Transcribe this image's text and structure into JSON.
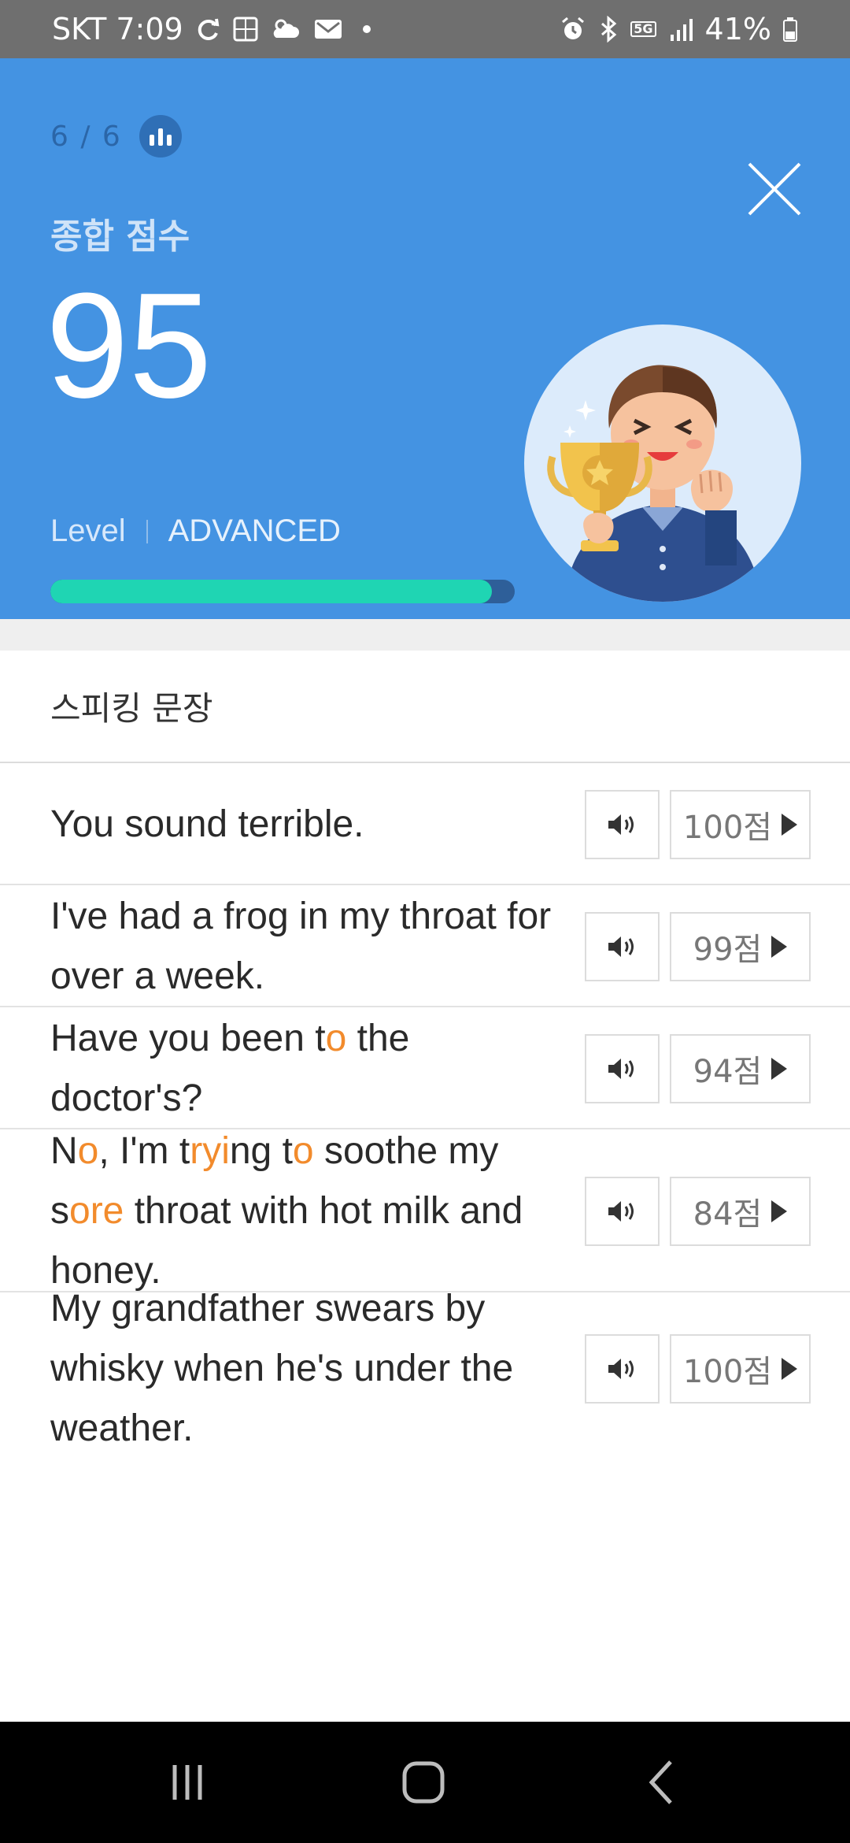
{
  "status_bar": {
    "carrier_time": "SKT 7:09",
    "network": "5G",
    "battery": "41%",
    "icons": [
      "sync-icon",
      "translate-icon",
      "weather-icon",
      "mail-icon",
      "alarm-icon",
      "bluetooth-icon",
      "signal-icon",
      "battery-icon"
    ]
  },
  "header": {
    "progress": "6 / 6",
    "score_label": "종합 점수",
    "score": "95",
    "level_label": "Level",
    "level_value": "ADVANCED",
    "level_progress_fraction": 0.95,
    "colors": {
      "background": "#4493e2",
      "progress_fill": "#1fd5b3",
      "progress_track": "#2e5f99"
    }
  },
  "section": {
    "title": "스피킹 문장"
  },
  "sentences": [
    {
      "parts": [
        {
          "t": "You sound terrible."
        }
      ],
      "score": "100점"
    },
    {
      "parts": [
        {
          "t": "I've had a frog in my throat for over a week."
        }
      ],
      "score": "99점"
    },
    {
      "parts": [
        {
          "t": "Have you been t"
        },
        {
          "t": "o",
          "hl": true
        },
        {
          "t": " the doctor's?"
        }
      ],
      "score": "94점"
    },
    {
      "parts": [
        {
          "t": "N"
        },
        {
          "t": "o",
          "hl": true
        },
        {
          "t": ", I'm t"
        },
        {
          "t": "ryi",
          "hl": true
        },
        {
          "t": "ng t"
        },
        {
          "t": "o",
          "hl": true
        },
        {
          "t": " soothe my s"
        },
        {
          "t": "ore",
          "hl": true
        },
        {
          "t": " throat with hot milk and honey."
        }
      ],
      "score": "84점"
    },
    {
      "parts": [
        {
          "t": "My grandfather swears by whisky when he's under the weather."
        }
      ],
      "score": "100점"
    }
  ],
  "highlight_color": "#f28b2c",
  "nav": {
    "buttons": [
      "recents-icon",
      "home-icon",
      "back-icon"
    ]
  }
}
